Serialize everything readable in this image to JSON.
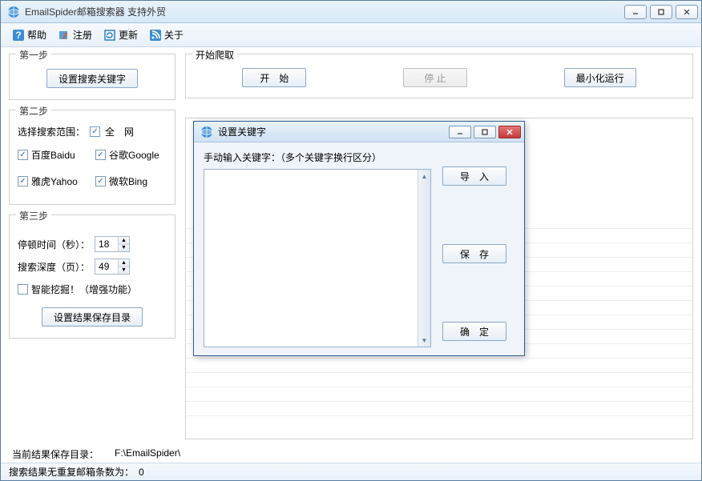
{
  "window": {
    "title": "EmailSpider邮箱搜索器 支持外贸"
  },
  "toolbar": {
    "help": "帮助",
    "register": "注册",
    "update": "更新",
    "about": "关于"
  },
  "step1": {
    "legend": "第一步",
    "set_keywords_btn": "设置搜索关键字"
  },
  "step2": {
    "legend": "第二步",
    "range_label": "选择搜索范围：",
    "all_net": "全　网",
    "baidu": "百度Baidu",
    "google": "谷歌Google",
    "yahoo": "雅虎Yahoo",
    "bing": "微软Bing"
  },
  "step3": {
    "legend": "第三步",
    "pause_label": "停顿时间（秒）：",
    "pause_value": "18",
    "depth_label": "搜索深度（页）：",
    "depth_value": "49",
    "smart_dig": "智能挖掘！（增强功能）",
    "set_result_dir_btn": "设置结果保存目录"
  },
  "crawl": {
    "legend": "开始爬取",
    "start": "开　始",
    "stop": "停 止",
    "minimize_run": "最小化运行"
  },
  "bottom": {
    "save_dir_label": "当前结果保存目录：",
    "save_dir_value": "F:\\EmailSpider\\"
  },
  "status": {
    "label": "搜索结果无重复邮箱条数为：",
    "count": "0"
  },
  "dialog": {
    "title": "设置关键字",
    "input_label": "手动输入关键字：（多个关键字换行区分）",
    "textarea_value": "",
    "import_btn": "导　入",
    "save_btn": "保　存",
    "ok_btn": "确　定"
  }
}
